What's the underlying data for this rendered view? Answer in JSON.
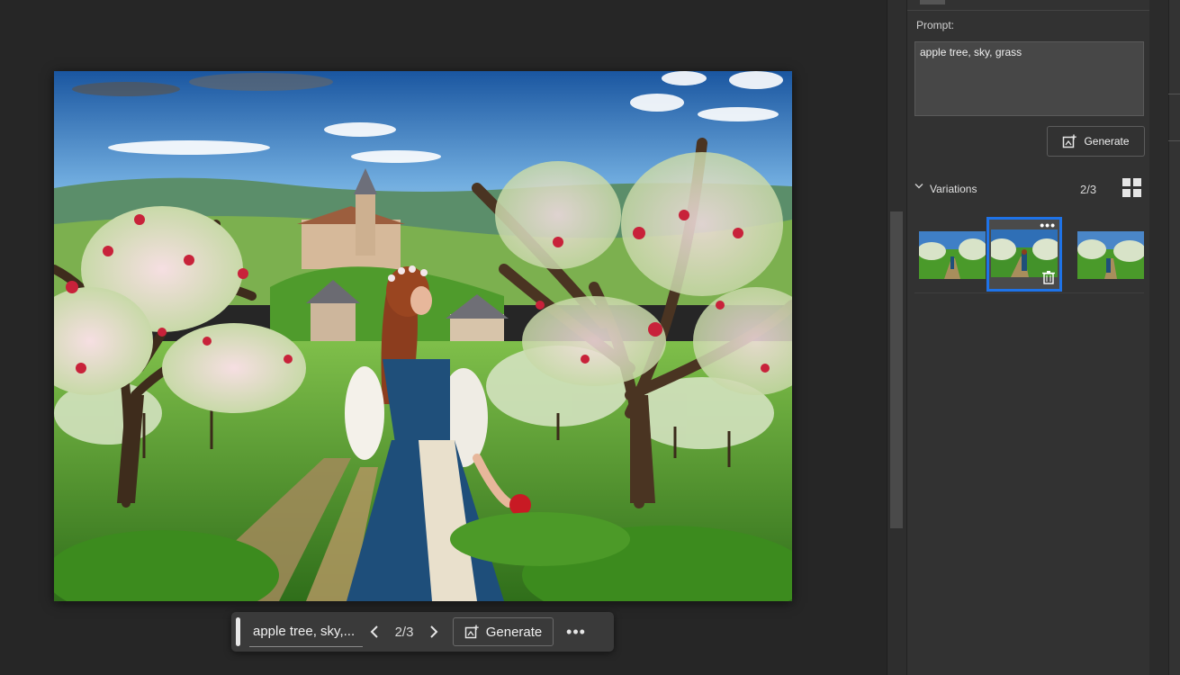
{
  "canvas": {
    "image_subject": "apple orchard with woman in blue dress holding red apple, castle on hill",
    "colors": {
      "sky_top": "#1d5fa8",
      "sky_mid": "#6aa7de",
      "grass": "#3f8f22",
      "dress": "#1f4f7a"
    }
  },
  "taskbar": {
    "prompt_preview": "apple tree, sky,...",
    "prev_icon": "chevron-left-icon",
    "counter": "2/3",
    "next_icon": "chevron-right-icon",
    "generate_label": "Generate",
    "generate_icon": "generate-image-icon",
    "more_icon": "more-icon",
    "more_glyph": "•••"
  },
  "panel": {
    "prompt_label": "Prompt:",
    "prompt_value": "apple tree, sky, grass",
    "generate_label": "Generate",
    "variations": {
      "title": "Variations",
      "count": "2/3",
      "expanded": true,
      "grid_icon": "grid-view-icon",
      "selected_index": 1,
      "items": [
        {
          "label": "variation-1"
        },
        {
          "label": "variation-2"
        },
        {
          "label": "variation-3"
        }
      ],
      "selected_more_glyph": "•••",
      "accent": "#1e73e8"
    }
  }
}
